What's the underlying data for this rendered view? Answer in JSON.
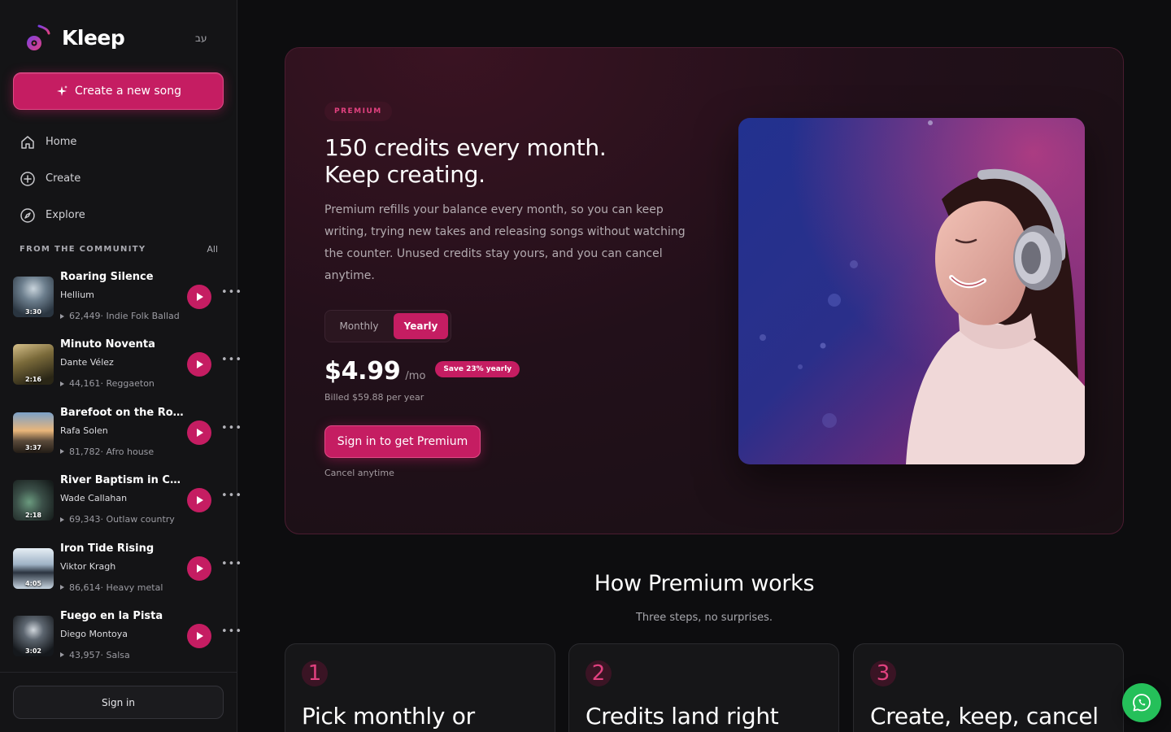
{
  "brand": {
    "name": "Kleep",
    "lang_toggle": "עב"
  },
  "sidebar": {
    "create_label": "Create a new song",
    "nav": [
      {
        "label": "Home",
        "icon": "home-icon"
      },
      {
        "label": "Create",
        "icon": "plus-circle-icon"
      },
      {
        "label": "Explore",
        "icon": "compass-icon"
      }
    ],
    "community": {
      "title": "FROM THE COMMUNITY",
      "all_label": "All",
      "songs": [
        {
          "title": "Roaring Silence",
          "artist": "Hellium",
          "duration": "3:30",
          "plays": "62,449",
          "genre": "· Indie Folk Ballad"
        },
        {
          "title": "Minuto Noventa",
          "artist": "Dante Vélez",
          "duration": "2:16",
          "plays": "44,161",
          "genre": "· Reggaeton"
        },
        {
          "title": "Barefoot on the Roof…",
          "artist": "Rafa Solen",
          "duration": "3:37",
          "plays": "81,782",
          "genre": "· Afro house"
        },
        {
          "title": "River Baptism in Col…",
          "artist": "Wade Callahan",
          "duration": "2:18",
          "plays": "69,343",
          "genre": "· Outlaw country"
        },
        {
          "title": "Iron Tide Rising",
          "artist": "Viktor Kragh",
          "duration": "4:05",
          "plays": "86,614",
          "genre": "· Heavy metal"
        },
        {
          "title": "Fuego en la Pista",
          "artist": "Diego Montoya",
          "duration": "3:02",
          "plays": "43,957",
          "genre": "· Salsa"
        }
      ]
    },
    "signin_label": "Sign in"
  },
  "hero": {
    "badge": "PREMIUM",
    "title": "150 credits every month. Keep creating.",
    "description": "Premium refills your balance every month, so you can keep writing, trying new takes and releasing songs without watching the counter. Unused credits stay yours, and you can cancel anytime.",
    "toggle": {
      "monthly": "Monthly",
      "yearly": "Yearly",
      "selected": "Yearly"
    },
    "price": "$4.99",
    "per": "/mo",
    "save_badge": "Save 23% yearly",
    "billed": "Billed $59.88 per year",
    "cta": "Sign in to get Premium",
    "cancel_note": "Cancel anytime"
  },
  "how": {
    "title": "How Premium works",
    "subtitle": "Three steps, no surprises.",
    "steps": [
      {
        "num": "1",
        "title": "Pick monthly or"
      },
      {
        "num": "2",
        "title": "Credits land right"
      },
      {
        "num": "3",
        "title": "Create, keep, cancel"
      }
    ]
  },
  "colors": {
    "accent": "#c51d62",
    "background": "#0d0d0f",
    "whatsapp": "#25c05a"
  }
}
